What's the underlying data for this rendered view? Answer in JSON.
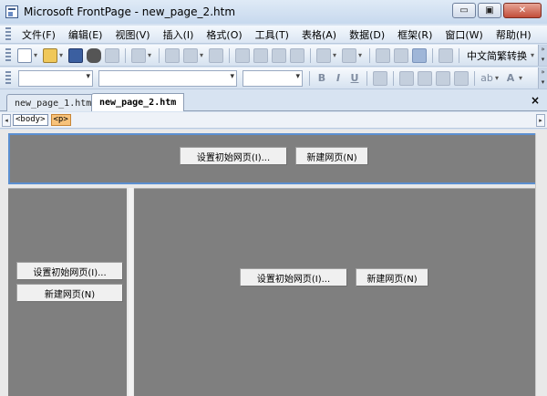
{
  "window": {
    "title": "Microsoft FrontPage - new_page_2.htm",
    "minimize": "▭",
    "maximize": "▣",
    "close": "✕"
  },
  "menubar": {
    "items": [
      "文件(F)",
      "编辑(E)",
      "视图(V)",
      "插入(I)",
      "格式(O)",
      "工具(T)",
      "表格(A)",
      "数据(D)",
      "框架(R)",
      "窗口(W)",
      "帮助(H)"
    ]
  },
  "toolbar": {
    "ime_label": "中文简繁转换",
    "bold": "B",
    "italic": "I",
    "underline": "U",
    "highlight": "ab",
    "font_color": "A"
  },
  "tabs": {
    "items": [
      "new_page_1.htm",
      "new_page_2.htm"
    ],
    "active": "new_page_2.htm",
    "close": "×"
  },
  "quicktag": {
    "left_arrow": "◂",
    "right_arrow": "▸",
    "tags": [
      "<body>",
      "<p>"
    ]
  },
  "frames": {
    "top": {
      "set_initial": "设置初始网页(I)...",
      "new_page": "新建网页(N)"
    },
    "left": {
      "set_initial": "设置初始网页(I)...",
      "new_page": "新建网页(N)"
    },
    "main": {
      "set_initial": "设置初始网页(I)...",
      "new_page": "新建网页(N)"
    }
  }
}
